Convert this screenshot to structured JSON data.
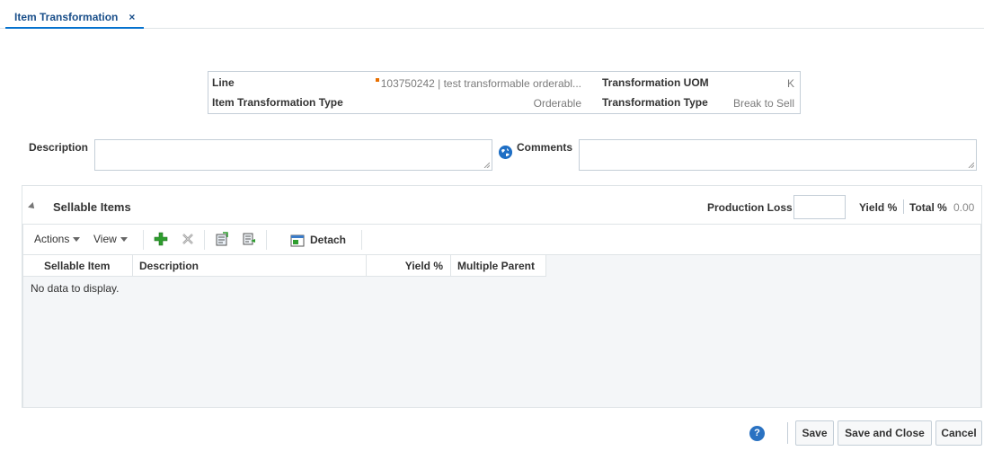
{
  "tab": {
    "label": "Item Transformation",
    "close": "×"
  },
  "header": {
    "line_label": "Line",
    "line_value": "103750242 | test transformable orderabl...",
    "uom_label": "Transformation UOM",
    "uom_value": "K",
    "itt_label": "Item Transformation Type",
    "itt_value": "Orderable",
    "tt_label": "Transformation Type",
    "tt_value": "Break to Sell"
  },
  "fields": {
    "description_label": "Description",
    "description_value": "",
    "comments_label": "Comments",
    "comments_value": ""
  },
  "sellable": {
    "title": "Sellable Items",
    "production_loss_label": "Production Loss",
    "production_loss_value": "",
    "yield_label": "Yield %",
    "total_label": "Total %",
    "total_value": "0.00",
    "toolbar": {
      "actions": "Actions",
      "view": "View",
      "detach": "Detach"
    },
    "columns": [
      "Sellable Item",
      "Description",
      "Yield %",
      "Multiple Parent"
    ],
    "empty_text": "No data to display."
  },
  "footer": {
    "help": "?",
    "save": "Save",
    "save_close": "Save and Close",
    "cancel": "Cancel"
  },
  "icons": [
    "close-icon",
    "globe-icon",
    "collapse-icon",
    "add-icon",
    "delete-icon",
    "export-icon",
    "edit-icon",
    "detach-icon",
    "help-icon"
  ],
  "colors": {
    "accent": "#0572ce",
    "tab_text": "#1a4f8a",
    "add_green": "#2e9d2e",
    "line_marker": "#e86f00"
  }
}
